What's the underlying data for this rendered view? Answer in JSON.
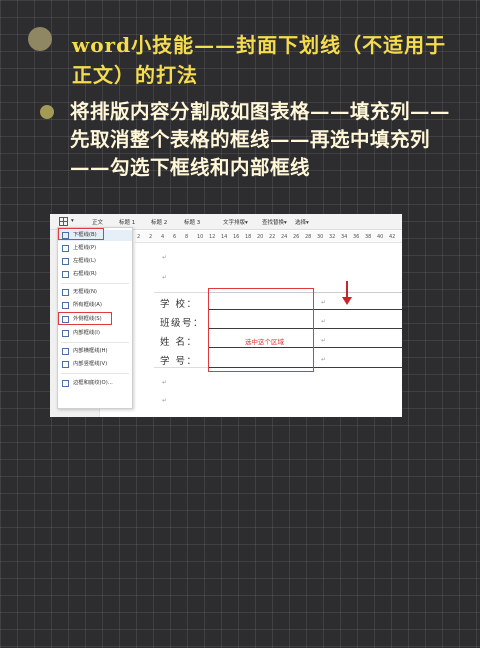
{
  "slide": {
    "heading": "word小技能——封面下划线（不适用于正文）的打法",
    "body": "将排版内容分割成如图表格——填充列——先取消整个表格的框线——再选中填充列——勾选下框线和内部框线"
  },
  "screenshot": {
    "toolbar": {
      "items": [
        "正文",
        "标题 1",
        "标题 2",
        "标题 3",
        "文字排版▾",
        "查找替换▾",
        "选择▾"
      ]
    },
    "ruler": [
      "2",
      "2",
      "4",
      "6",
      "8",
      "10",
      "12",
      "14",
      "16",
      "18",
      "20",
      "22",
      "24",
      "26",
      "28",
      "30",
      "32",
      "34",
      "36",
      "38",
      "40",
      "42"
    ],
    "menu": {
      "items": [
        "下框线(B)",
        "上框线(P)",
        "左框线(L)",
        "右框线(R)",
        "无框线(N)",
        "所有框线(A)",
        "外侧框线(S)",
        "内部框线(I)",
        "内部横框线(H)",
        "内部竖框线(V)",
        "边框和底纹(O)..."
      ]
    },
    "table": {
      "labels": [
        "学 校：",
        "班级号：",
        "姓 名：",
        "学 号："
      ],
      "selection_note": "选中这个区域"
    },
    "colors": {
      "highlight": "#e0393e",
      "heading": "#f4dc4e"
    }
  }
}
